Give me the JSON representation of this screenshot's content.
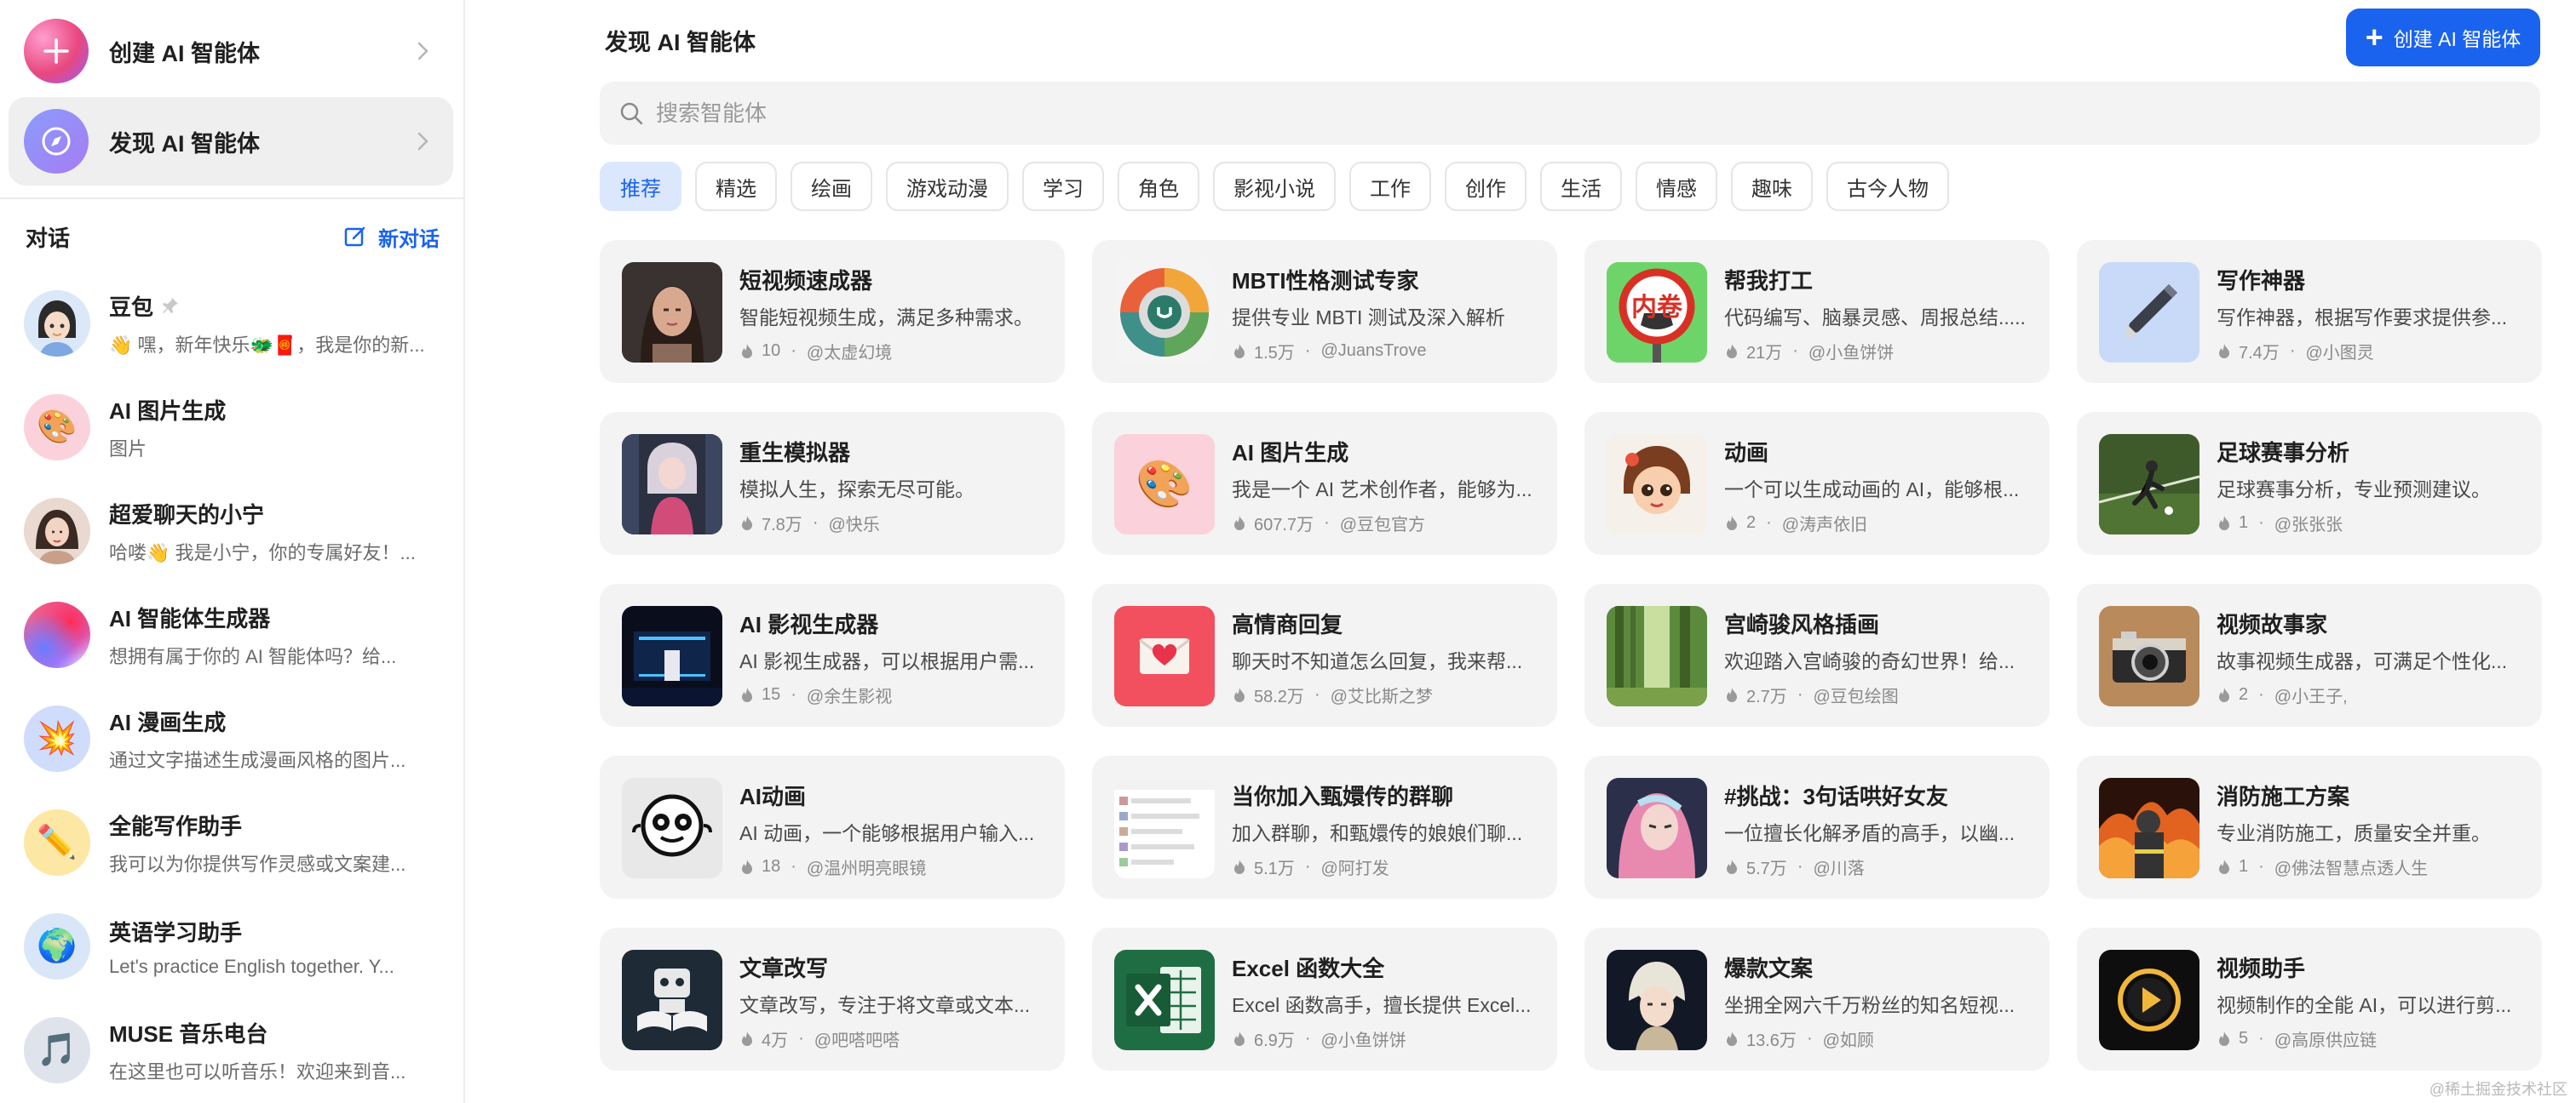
{
  "sidebar": {
    "create_label": "创建 AI 智能体",
    "discover_label": "发现 AI 智能体",
    "conversations_title": "对话",
    "new_chat_label": "新对话",
    "chats": [
      {
        "name": "豆包",
        "preview": "👋 嘿，新年快乐🐲🧧，我是你的新...",
        "avatar": "girl-avatar",
        "pinned": true
      },
      {
        "name": "AI 图片生成",
        "preview": "图片",
        "avatar": "palette"
      },
      {
        "name": "超爱聊天的小宁",
        "preview": "哈喽👋 我是小宁，你的专属好友！...",
        "avatar": "portrait"
      },
      {
        "name": "AI 智能体生成器",
        "preview": "想拥有属于你的 AI 智能体吗？给...",
        "avatar": "gradient-orb"
      },
      {
        "name": "AI 漫画生成",
        "preview": "通过文字描述生成漫画风格的图片...",
        "avatar": "💥"
      },
      {
        "name": "全能写作助手",
        "preview": "我可以为你提供写作灵感或文案建...",
        "avatar": "✏️"
      },
      {
        "name": "英语学习助手",
        "preview": "Let's practice English together. Y...",
        "avatar": "🌍"
      },
      {
        "name": "MUSE 音乐电台",
        "preview": "在这里也可以听音乐！欢迎来到音...",
        "avatar": "🎵"
      }
    ]
  },
  "main": {
    "title": "发现 AI 智能体",
    "create_button": "创建 AI 智能体",
    "search_placeholder": "搜索智能体",
    "tabs": [
      "推荐",
      "精选",
      "绘画",
      "游戏动漫",
      "学习",
      "角色",
      "影视小说",
      "工作",
      "创作",
      "生活",
      "情感",
      "趣味",
      "古今人物"
    ],
    "active_tab": 0,
    "cards": [
      {
        "title": "短视频速成器",
        "desc": "智能短视频生成，满足多种需求。",
        "count": "10",
        "author": "@太虚幻境",
        "thumb": "portrait-woman"
      },
      {
        "title": "MBTI性格测试专家",
        "desc": "提供专业 MBTI 测试及深入解析",
        "count": "1.5万",
        "author": "@JuansTrove",
        "thumb": "mbti-wheel"
      },
      {
        "title": "帮我打工",
        "desc": "代码编写、脑暴灵感、周报总结.....",
        "count": "21万",
        "author": "@小鱼饼饼",
        "thumb": "neijuan-sign",
        "sign_text": "内卷"
      },
      {
        "title": "写作神器",
        "desc": "写作神器，根据写作要求提供参...",
        "count": "7.4万",
        "author": "@小图灵",
        "thumb": "pen"
      },
      {
        "title": "重生模拟器",
        "desc": "模拟人生，探索无尽可能。",
        "count": "7.8万",
        "author": "@快乐",
        "thumb": "anime-girl"
      },
      {
        "title": "AI 图片生成",
        "desc": "我是一个 AI 艺术创作者，能够为...",
        "count": "607.7万",
        "author": "@豆包官方",
        "thumb": "palette"
      },
      {
        "title": "动画",
        "desc": "一个可以生成动画的 AI，能够根...",
        "count": "2",
        "author": "@涛声依旧",
        "thumb": "cartoon-child"
      },
      {
        "title": "足球赛事分析",
        "desc": "足球赛事分析，专业预测建议。",
        "count": "1",
        "author": "@张张张",
        "thumb": "football"
      },
      {
        "title": "AI 影视生成器",
        "desc": "AI 影视生成器，可以根据用户需...",
        "count": "15",
        "author": "@余生影视",
        "thumb": "neon-tunnel"
      },
      {
        "title": "高情商回复",
        "desc": "聊天时不知道怎么回复，我来帮...",
        "count": "58.2万",
        "author": "@艾比斯之梦",
        "thumb": "love-letter"
      },
      {
        "title": "宫崎骏风格插画",
        "desc": "欢迎踏入宫崎骏的奇幻世界！给...",
        "count": "2.7万",
        "author": "@豆包绘图",
        "thumb": "forest"
      },
      {
        "title": "视频故事家",
        "desc": "故事视频生成器，可满足个性化...",
        "count": "2",
        "author": "@小王子,",
        "thumb": "camera"
      },
      {
        "title": "AI动画",
        "desc": "AI 动画，一个能够根据用户输入...",
        "count": "18",
        "author": "@温州明亮眼镜",
        "thumb": "mascot-logo"
      },
      {
        "title": "当你加入甄嬛传的群聊",
        "desc": "加入群聊，和甄嬛传的娘娘们聊...",
        "count": "5.1万",
        "author": "@阿打发",
        "thumb": "chat-screenshot"
      },
      {
        "title": "#挑战：3句话哄好女友",
        "desc": "一位擅长化解矛盾的高手，以幽...",
        "count": "5.7万",
        "author": "@川落",
        "thumb": "pink-hair-girl"
      },
      {
        "title": "消防施工方案",
        "desc": "专业消防施工，质量安全并重。",
        "count": "1",
        "author": "@佛法智慧点透人生",
        "thumb": "firefighter"
      },
      {
        "title": "文章改写",
        "desc": "文章改写，专注于将文章或文本...",
        "count": "4万",
        "author": "@吧嗒吧嗒",
        "thumb": "robot-book"
      },
      {
        "title": "Excel 函数大全",
        "desc": "Excel 函数高手，擅长提供 Excel...",
        "count": "6.9万",
        "author": "@小鱼饼饼",
        "thumb": "excel-logo"
      },
      {
        "title": "爆款文案",
        "desc": "坐拥全网六千万粉丝的知名短视...",
        "count": "13.6万",
        "author": "@如顾",
        "thumb": "anime-boy"
      },
      {
        "title": "视频助手",
        "desc": "视频制作的全能 AI，可以进行剪...",
        "count": "5",
        "author": "@高原供应链",
        "thumb": "play-button"
      }
    ]
  },
  "watermark": "@稀土掘金技术社区",
  "colors": {
    "accent": "#1a63ef",
    "card_bg": "#f3f3f3",
    "active_tab_bg": "#dbe7fd"
  }
}
